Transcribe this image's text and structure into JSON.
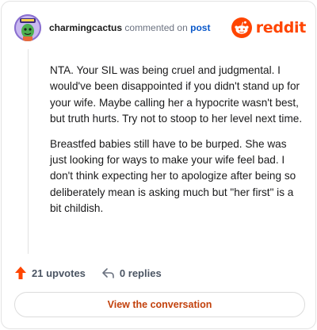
{
  "header": {
    "username": "charmingcactus",
    "action_text": "commented on",
    "target_link": "post",
    "avatar_icon": "cactus-avatar-icon",
    "logo_icon": "reddit-snoo-icon",
    "logo_text": "reddit",
    "logo_color": "#ff4500"
  },
  "comment": {
    "paragraph_1": "NTA. Your SIL was being cruel and judgmental. I would've been disappointed if you didn't stand up for your wife. Maybe calling her a hypocrite wasn't best, but truth hurts. Try not to stoop to her level next time.",
    "paragraph_2": "Breastfed babies still have to be burped. She was just looking for ways to make your wife feel bad. I don't think expecting her to apologize after being so deliberately mean is asking much but \"her first\" is a bit childish."
  },
  "actions": {
    "upvotes_label": "21 upvotes",
    "replies_label": "0 replies",
    "upvote_icon": "upvote-arrow-icon",
    "reply_icon": "reply-arrow-icon",
    "upvote_color": "#ff4500"
  },
  "cta": {
    "label": "View the conversation"
  }
}
